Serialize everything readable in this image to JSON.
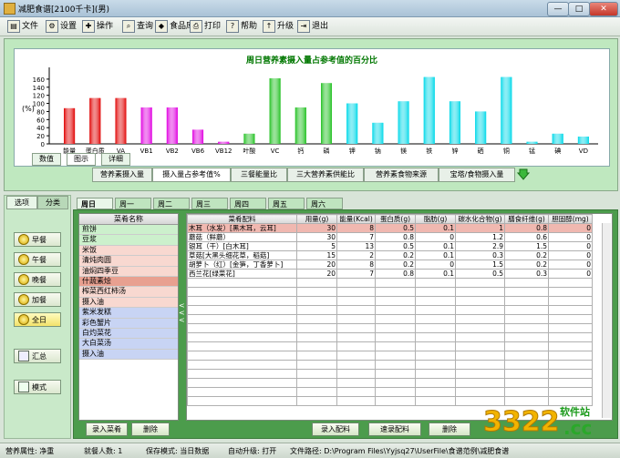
{
  "window": {
    "title": "减肥食谱[2100千卡](男)",
    "buttons": {
      "minimize": "—",
      "maximize": "□",
      "close": "✕"
    }
  },
  "toolbar": [
    {
      "label": "文件",
      "icon": "file-icon",
      "glyph": "▤"
    },
    {
      "label": "设置",
      "icon": "settings-icon",
      "glyph": "⚙"
    },
    {
      "label": "操作",
      "icon": "operation-icon",
      "glyph": "✚"
    },
    {
      "label": "查询",
      "icon": "query-icon",
      "glyph": "⌕"
    },
    {
      "label": "食品库",
      "icon": "food-library-icon",
      "glyph": "◆"
    },
    {
      "label": "打印",
      "icon": "print-icon",
      "glyph": "⎙"
    },
    {
      "label": "帮助",
      "icon": "help-icon",
      "glyph": "?"
    },
    {
      "label": "升级",
      "icon": "upgrade-icon",
      "glyph": "↑"
    },
    {
      "label": "退出",
      "icon": "exit-icon",
      "glyph": "⇥"
    }
  ],
  "chart_data": {
    "type": "bar",
    "title": "周日营养素摄入量占参考值的百分比",
    "ylabel": "(%)",
    "ylim": [
      0,
      180
    ],
    "yticks": [
      0,
      20,
      40,
      60,
      80,
      100,
      120,
      140,
      160
    ],
    "grid": false,
    "categories": [
      "能量",
      "蛋白质",
      "VA",
      "VB1",
      "VB2",
      "VB6",
      "VB12",
      "叶酸",
      "VC",
      "钙",
      "磷",
      "钾",
      "钠",
      "镁",
      "铁",
      "锌",
      "硒",
      "铜",
      "锰",
      "碘",
      "VD"
    ],
    "values": [
      88,
      113,
      113,
      90,
      90,
      35,
      5,
      25,
      162,
      90,
      150,
      100,
      52,
      105,
      165,
      105,
      80,
      165,
      5,
      25,
      18
    ],
    "colors": [
      "#e00000",
      "#e00000",
      "#e00000",
      "#e000e0",
      "#e000e0",
      "#e000e0",
      "#e000e0",
      "#20c020",
      "#20c020",
      "#20c020",
      "#20c020",
      "#00d8e8",
      "#00d8e8",
      "#00d8e8",
      "#00d8e8",
      "#00d8e8",
      "#00d8e8",
      "#00d8e8",
      "#00d8e8",
      "#00d8e8",
      "#00d8e8"
    ]
  },
  "chart_tabs": [
    "数值",
    "图示",
    "详细"
  ],
  "chart_tabs_active": 1,
  "bottom_tabs": [
    "营养素摄入量",
    "摄入量占参考值%",
    "三餐能量比",
    "三大营养素供能比",
    "营养素食物来源",
    "宝塔/食物摄入量"
  ],
  "bottom_tabs_active": 1,
  "left_panel": {
    "tabs": [
      "选项",
      "分类"
    ],
    "meals": [
      {
        "label": "早餐",
        "icon": "breakfast-icon"
      },
      {
        "label": "午餐",
        "icon": "lunch-icon"
      },
      {
        "label": "晚餐",
        "icon": "dinner-icon"
      },
      {
        "label": "加餐",
        "icon": "snack-icon"
      },
      {
        "label": "全日",
        "icon": "all-day-icon"
      }
    ],
    "summary_button": "汇总",
    "mode_button": "模式"
  },
  "days": [
    "周日",
    "周一",
    "周二",
    "周三",
    "周四",
    "周五",
    "周六"
  ],
  "days_active": 0,
  "dish_list": {
    "header": "菜肴名称",
    "items": [
      {
        "name": "煎饼",
        "bg": "#ccf0cc"
      },
      {
        "name": "豆浆",
        "bg": "#ccf0cc"
      },
      {
        "name": "米饭",
        "bg": "#f8d8d0"
      },
      {
        "name": "清炖肉圆",
        "bg": "#f8d8d0"
      },
      {
        "name": "油焖四季豆",
        "bg": "#f8d8d0"
      },
      {
        "name": "什蔬素烩",
        "bg": "#e8a090"
      },
      {
        "name": "榨菜西红柿汤",
        "bg": "#f8d8d0"
      },
      {
        "name": "摄入油",
        "bg": "#f8d8d0"
      },
      {
        "name": "紫米发糕",
        "bg": "#c8d4f4"
      },
      {
        "name": "彩色蟹片",
        "bg": "#c8d4f4"
      },
      {
        "name": "白灼菜花",
        "bg": "#c8d4f4"
      },
      {
        "name": "大白菜汤",
        "bg": "#c8d4f4"
      },
      {
        "name": "摄入油",
        "bg": "#c8d4f4"
      }
    ],
    "buttons": {
      "add": "录入菜肴",
      "delete": "删除"
    }
  },
  "ingredients": {
    "columns": [
      "菜肴配料",
      "用量(g)",
      "能量(Kcal)",
      "蛋白质(g)",
      "脂肪(g)",
      "碳水化合物(g)",
      "膳食纤维(g)",
      "胆固醇(mg)"
    ],
    "rows": [
      [
        "木耳（水发）[黑木耳，云耳]",
        "30",
        "8",
        "0.5",
        "0.1",
        "1",
        "0.8",
        "0"
      ],
      [
        "蘑菇（鲜蘑）",
        "30",
        "7",
        "0.8",
        "0",
        "1.2",
        "0.6",
        "0"
      ],
      [
        "银耳（干）[白木耳]",
        "5",
        "13",
        "0.5",
        "0.1",
        "2.9",
        "1.5",
        "0"
      ],
      [
        "草菇[大黑头细花草，稻菇]",
        "15",
        "2",
        "0.2",
        "0.1",
        "0.3",
        "0.2",
        "0"
      ],
      [
        "胡萝卜（红）[金笋，丁香萝卜]",
        "20",
        "8",
        "0.2",
        "0",
        "1.5",
        "0.2",
        "0"
      ],
      [
        "西兰花[绿菜花]",
        "20",
        "7",
        "0.8",
        "0.1",
        "0.5",
        "0.3",
        "0"
      ]
    ],
    "buttons": {
      "add": "录入配料",
      "replace": "速录配料",
      "delete": "删除"
    }
  },
  "status": {
    "brand": "营养属性: 净重",
    "people": "就餐人数: 1",
    "save_mode": "保存模式: 当日数据",
    "auto_upgrade": "自动升级: 打开",
    "file_path": "文件路径: D:\\Program Files\\Yyjsq27\\UserFile\\食谱范例\\减肥食谱"
  },
  "watermark": {
    "main": "3322",
    "tld": ".cc",
    "site": "软件站"
  }
}
